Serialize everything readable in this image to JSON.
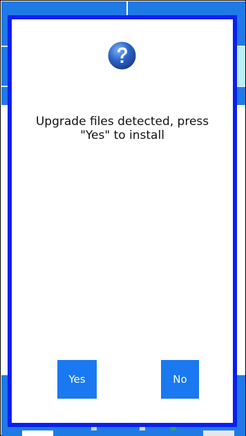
{
  "dialog": {
    "icon": "question-icon",
    "message": "Upgrade files detected, press\n\"Yes\" to install",
    "yes_label": "Yes",
    "no_label": "No"
  },
  "colors": {
    "dialog_border": "#0b1ff2",
    "button_bg": "#1a79f0",
    "app_blue": "#1f7ae6",
    "icon_blue": "#2a63c8"
  }
}
